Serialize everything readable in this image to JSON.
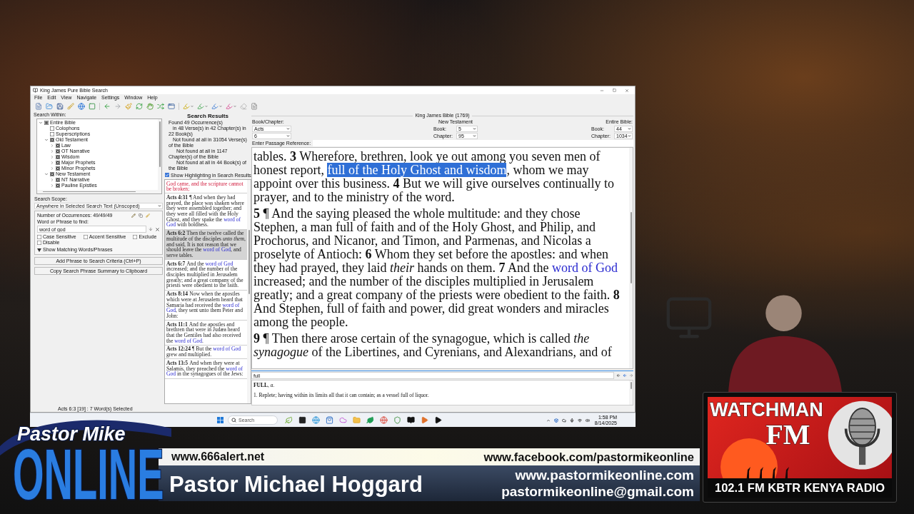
{
  "app": {
    "title": "King James Pure Bible Search",
    "menu": [
      "File",
      "Edit",
      "View",
      "Navigate",
      "Settings",
      "Window",
      "Help"
    ]
  },
  "search_within": {
    "label": "Search Within:",
    "tree": [
      {
        "label": "Entire Bible",
        "expanded": true,
        "partial": true,
        "children": [
          {
            "label": "Colophons",
            "checked": false
          },
          {
            "label": "Superscriptions",
            "checked": false
          },
          {
            "label": "Old Testament",
            "checked": true,
            "expanded": true,
            "children": [
              {
                "label": "Law",
                "checked": true,
                "expanded": false
              },
              {
                "label": "OT Narrative",
                "checked": true,
                "expanded": false
              },
              {
                "label": "Wisdom",
                "checked": true,
                "expanded": false
              },
              {
                "label": "Major Prophets",
                "checked": true,
                "expanded": false
              },
              {
                "label": "Minor Prophets",
                "checked": true,
                "expanded": false
              }
            ]
          },
          {
            "label": "New Testament",
            "checked": true,
            "expanded": true,
            "children": [
              {
                "label": "NT Narrative",
                "checked": true,
                "expanded": false
              },
              {
                "label": "Pauline Epistles",
                "checked": true,
                "expanded": false
              }
            ]
          }
        ]
      }
    ]
  },
  "search_scope": {
    "label": "Search Scope:",
    "value": "Anywhere in Selected Search Text (Unscoped)"
  },
  "criteria": {
    "occurrences": "Number of Occurrences: 49/49/49",
    "phrase_label": "Word or Phrase to find:",
    "phrase": "word of god",
    "options": [
      {
        "label": "Case Sensitive",
        "checked": false
      },
      {
        "label": "Accent Sensitive",
        "checked": false
      },
      {
        "label": "Exclude",
        "checked": false
      },
      {
        "label": "Disable",
        "checked": false
      }
    ],
    "matching": "Show Matching Words/Phrases",
    "buttons": [
      "Add Phrase to Search Criteria (Ctrl+P)",
      "Copy Search Phrase Summary to Clipboard"
    ]
  },
  "results": {
    "title": "Search Results",
    "summary": [
      "Found 49 Occurrence(s)",
      "in 48 Verse(s) in 42 Chapter(s) in 22 Book(s)",
      "Not found at all in 31054 Verse(s) of the Bible",
      "Not found at all in 1147 Chapter(s) of the Bible",
      "Not found at all in 44 Book(s) of the Bible"
    ],
    "highlight": {
      "label": "Show Highlighting in Search Results",
      "checked": true
    },
    "verses": [
      {
        "selected": false,
        "segments": [
          {
            "kind": "red",
            "text": "God came, and the scripture cannot be broken;"
          }
        ]
      },
      {
        "ref": "Acts 4:31",
        "selected": false,
        "segments": [
          {
            "kind": "text",
            "text": "¶ And when they had prayed, the place was shaken where they were assembled together; and they were all filled with the Holy Ghost, and they spake the "
          },
          {
            "kind": "match",
            "text": "word of God"
          },
          {
            "kind": "text",
            "text": " with boldness."
          }
        ]
      },
      {
        "ref": "Acts 6:2",
        "selected": true,
        "segments": [
          {
            "kind": "text",
            "text": "Then the twelve called the multitude of the disciples "
          },
          {
            "kind": "italic",
            "text": "unto them"
          },
          {
            "kind": "text",
            "text": ", and said, It is not reason that we should leave the "
          },
          {
            "kind": "match",
            "text": "word of God"
          },
          {
            "kind": "text",
            "text": ", and serve tables."
          }
        ]
      },
      {
        "ref": "Acts 6:7",
        "selected": false,
        "segments": [
          {
            "kind": "text",
            "text": "And the "
          },
          {
            "kind": "match",
            "text": "word of God"
          },
          {
            "kind": "text",
            "text": " increased; and the number of the disciples multiplied in Jerusalem greatly; and a great company of the priests were obedient to the faith."
          }
        ]
      },
      {
        "ref": "Acts 8:14",
        "selected": false,
        "segments": [
          {
            "kind": "text",
            "text": "Now when the apostles which were at Jerusalem heard that Samaria had received the "
          },
          {
            "kind": "match",
            "text": "word of God"
          },
          {
            "kind": "text",
            "text": ", they sent unto them Peter and John:"
          }
        ]
      },
      {
        "ref": "Acts 11:1",
        "selected": false,
        "segments": [
          {
            "kind": "text",
            "text": "And the apostles and brethren that were in Judæa heard that the Gentiles had also received the "
          },
          {
            "kind": "match",
            "text": "word of God"
          },
          {
            "kind": "text",
            "text": "."
          }
        ]
      },
      {
        "ref": "Acts 12:24",
        "selected": false,
        "segments": [
          {
            "kind": "text",
            "text": "¶ But the "
          },
          {
            "kind": "match",
            "text": "word of God"
          },
          {
            "kind": "text",
            "text": " grew and multiplied."
          }
        ]
      },
      {
        "ref": "Acts 13:5",
        "selected": false,
        "segments": [
          {
            "kind": "text",
            "text": "And when they were at Salamis, they preached the "
          },
          {
            "kind": "match",
            "text": "word of God"
          },
          {
            "kind": "text",
            "text": " in the synagogues of the Jews:"
          }
        ]
      }
    ]
  },
  "passage": {
    "bible": "King James Bible (1769)",
    "book_chapter": {
      "label": "Book/Chapter:",
      "book": "Acts",
      "chapter": "6"
    },
    "testament": {
      "label": "New Testament",
      "book_label": "Book:",
      "book": "5",
      "chapter_label": "Chapter:",
      "chapter": "95"
    },
    "entire": {
      "label": "Entire Bible:",
      "book_label": "Book:",
      "book": "44",
      "chapter_label": "Chapter:",
      "chapter": "1034"
    },
    "reference_label": "Enter Passage Reference:",
    "paragraphs": [
      {
        "segments": [
          {
            "kind": "text",
            "text": "tables. "
          },
          {
            "kind": "verse",
            "text": "3"
          },
          {
            "kind": "text",
            "text": " Wherefore, brethren, look ye out among you seven men of honest report, "
          },
          {
            "kind": "selected",
            "text": "full of the Holy Ghost and wisdom"
          },
          {
            "kind": "text",
            "text": ", whom we may appoint over this business. "
          },
          {
            "kind": "verse",
            "text": "4"
          },
          {
            "kind": "text",
            "text": " But we will give ourselves continually to prayer, and to the ministry of the word."
          }
        ]
      },
      {
        "segments": [
          {
            "kind": "verse",
            "text": "5"
          },
          {
            "kind": "text",
            "text": " ¶ And the saying pleased the whole multitude: and they chose Stephen, a man full of faith and of the Holy Ghost, and Philip, and Prochorus, and Nicanor, and Timon, and Parmenas, and Nicolas a proselyte of Antioch: "
          },
          {
            "kind": "verse",
            "text": "6"
          },
          {
            "kind": "text",
            "text": " Whom they set before the apostles: and when they had prayed, they laid "
          },
          {
            "kind": "italic",
            "text": "their"
          },
          {
            "kind": "text",
            "text": " hands on them. "
          },
          {
            "kind": "verse",
            "text": "7"
          },
          {
            "kind": "text",
            "text": " And the "
          },
          {
            "kind": "match",
            "text": "word of God"
          },
          {
            "kind": "text",
            "text": " increased; and the number of the disciples multiplied in Jerusalem greatly; and a great company of the priests were obedient to the faith. "
          },
          {
            "kind": "verse",
            "text": "8"
          },
          {
            "kind": "text",
            "text": " And Stephen, full of faith and power, did great wonders and miracles among the people."
          }
        ]
      },
      {
        "segments": [
          {
            "kind": "verse",
            "text": "9"
          },
          {
            "kind": "text",
            "text": " ¶ Then there arose certain of the synagogue, which is called "
          },
          {
            "kind": "italic",
            "text": "the synagogue"
          },
          {
            "kind": "text",
            "text": " of the Libertines, and Cyrenians, and Alexandrians, and of"
          }
        ]
      }
    ]
  },
  "dictionary": {
    "query": "full",
    "entry": "**FULL**, *a.*",
    "definition": "1. Replete; having within its limits all that it can contain; as a vessel full of liquor."
  },
  "status_bar": "Acts 6:3 [19] : 7 Word(s) Selected",
  "taskbar": {
    "search_placeholder": "Search",
    "time": "1:58 PM",
    "date": "8/14/2025"
  },
  "logo": {
    "line_1": "Pastor Mike",
    "line_2": "ONLINE"
  },
  "banner": {
    "website": "www.666alert.net",
    "facebook": "www.facebook.com/pastormikeonline",
    "name": "Pastor Michael Hoggard",
    "site": "www.pastormikeonline.com",
    "email": "pastormikeonline@gmail.com"
  },
  "radio_poster": {
    "title": "WATCHMAN",
    "subtitle": "FM",
    "frequency": "102.1 FM KBTR KENYA RADIO"
  }
}
